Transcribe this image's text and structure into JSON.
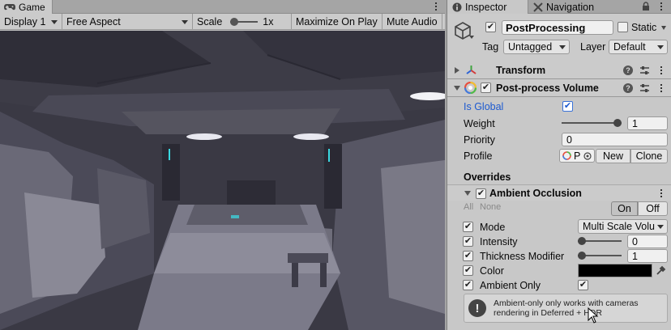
{
  "game": {
    "tab_label": "Game",
    "toolbar": {
      "display": "Display 1",
      "aspect": "Free Aspect",
      "scale_label": "Scale",
      "scale_value": "1x",
      "maximize": "Maximize On Play",
      "mute": "Mute Audio"
    }
  },
  "inspector": {
    "tabs": {
      "inspector": "Inspector",
      "navigation": "Navigation"
    },
    "object": {
      "name": "PostProcessing",
      "static_label": "Static",
      "tag_label": "Tag",
      "tag_value": "Untagged",
      "layer_label": "Layer",
      "layer_value": "Default"
    },
    "transform": {
      "title": "Transform"
    },
    "volume": {
      "title": "Post-process Volume",
      "is_global_label": "Is Global",
      "weight_label": "Weight",
      "weight_value": "1",
      "weight_fraction": 1.0,
      "priority_label": "Priority",
      "priority_value": "0",
      "profile_label": "Profile",
      "profile_value": "P",
      "new_label": "New",
      "clone_label": "Clone"
    },
    "overrides": {
      "title": "Overrides",
      "effect": {
        "title": "Ambient Occlusion",
        "all_label": "All",
        "none_label": "None",
        "on_label": "On",
        "off_label": "Off",
        "mode_label": "Mode",
        "mode_value": "Multi Scale Volu",
        "intensity_label": "Intensity",
        "intensity_value": "0",
        "intensity_fraction": 0.0,
        "thickness_label": "Thickness Modifier",
        "thickness_value": "1",
        "thickness_fraction": 0.0,
        "color_label": "Color",
        "color_value": "#000000",
        "ambient_only_label": "Ambient Only",
        "help_text": "Ambient-only only works with cameras rendering in Deferred + HDR"
      }
    }
  },
  "colors": {
    "link_blue": "#1d5ad0",
    "panel_bg": "#c8c8c8",
    "scene_dark": "#3a3944"
  }
}
